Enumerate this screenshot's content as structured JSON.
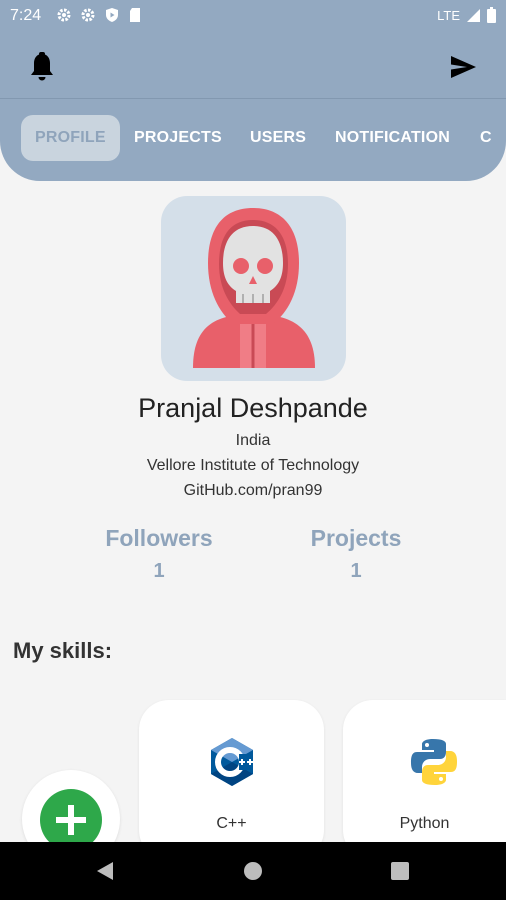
{
  "status_bar": {
    "time": "7:24",
    "network": "LTE"
  },
  "tabs": [
    {
      "label": "PROFILE",
      "active": true
    },
    {
      "label": "PROJECTS",
      "active": false
    },
    {
      "label": "USERS",
      "active": false
    },
    {
      "label": "NOTIFICATION",
      "active": false
    },
    {
      "label": "C",
      "active": false
    }
  ],
  "profile": {
    "name": "Pranjal Deshpande",
    "country": "India",
    "institute": "Vellore Institute of Technology",
    "github": "GitHub.com/pran99"
  },
  "stats": {
    "followers_label": "Followers",
    "followers_value": "1",
    "projects_label": "Projects",
    "projects_value": "1"
  },
  "skills": {
    "title": "My skills:",
    "items": [
      {
        "name": "C++",
        "icon": "cpp-logo-icon"
      },
      {
        "name": "Python",
        "icon": "python-logo-icon"
      }
    ]
  },
  "colors": {
    "primary": "#93a9c1",
    "accent_text": "#8fa4bb",
    "fab": "#2ea84a"
  }
}
